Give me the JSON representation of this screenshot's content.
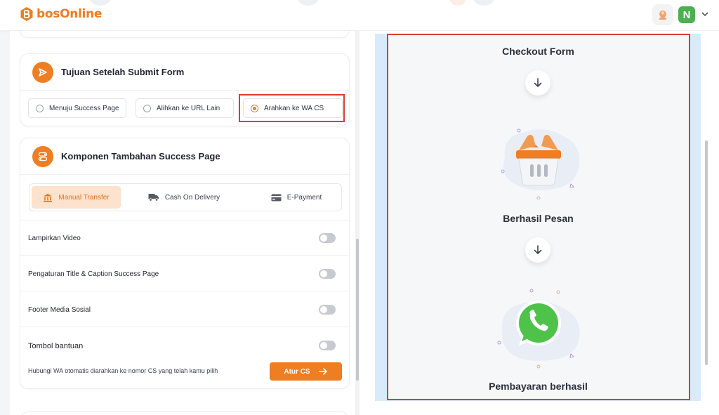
{
  "header": {
    "logo_text": "bosOnline",
    "avatar_initial": "N",
    "icons": [
      "bosonline-logo-icon",
      "notification-avatar-icon",
      "chevron-down-icon"
    ]
  },
  "tujuan_card": {
    "title": "Tujuan Setelah Submit Form",
    "options": [
      {
        "label": "Menuju Success Page",
        "selected": false
      },
      {
        "label": "Alihkan ke URL Lain",
        "selected": false
      },
      {
        "label": "Arahkan ke WA CS",
        "selected": true
      }
    ]
  },
  "komponen_card": {
    "title": "Komponen Tambahan Success Page",
    "tabs": [
      {
        "label": "Manual Transfer",
        "icon": "bank-icon",
        "active": true
      },
      {
        "label": "Cash On Delivery",
        "icon": "truck-icon",
        "active": false
      },
      {
        "label": "E-Payment",
        "icon": "credit-card-icon",
        "active": false
      }
    ],
    "settings": [
      {
        "label": "Lampirkan Video",
        "enabled": false
      },
      {
        "label": "Pengaturan Title & Caption Success Page",
        "enabled": false
      },
      {
        "label": "Footer Media Sosial",
        "enabled": false
      },
      {
        "label": "Tombol bantuan",
        "enabled": false
      }
    ],
    "help_text": "Hubungi WA otomatis diarahkan ke nomor CS yang telah kamu pilih",
    "button_label": "Atur CS"
  },
  "preview": {
    "steps": [
      "Checkout Form",
      "Berhasil Pesan",
      "Pembayaran berhasil"
    ],
    "icons": [
      "arrow-down-icon",
      "shopping-basket-icon",
      "whatsapp-icon"
    ]
  },
  "colors": {
    "accent": "#ef7d22",
    "highlight_border": "#e03b2d",
    "whatsapp_green": "#4fc24a",
    "preview_strip": "#d9ebfa"
  }
}
